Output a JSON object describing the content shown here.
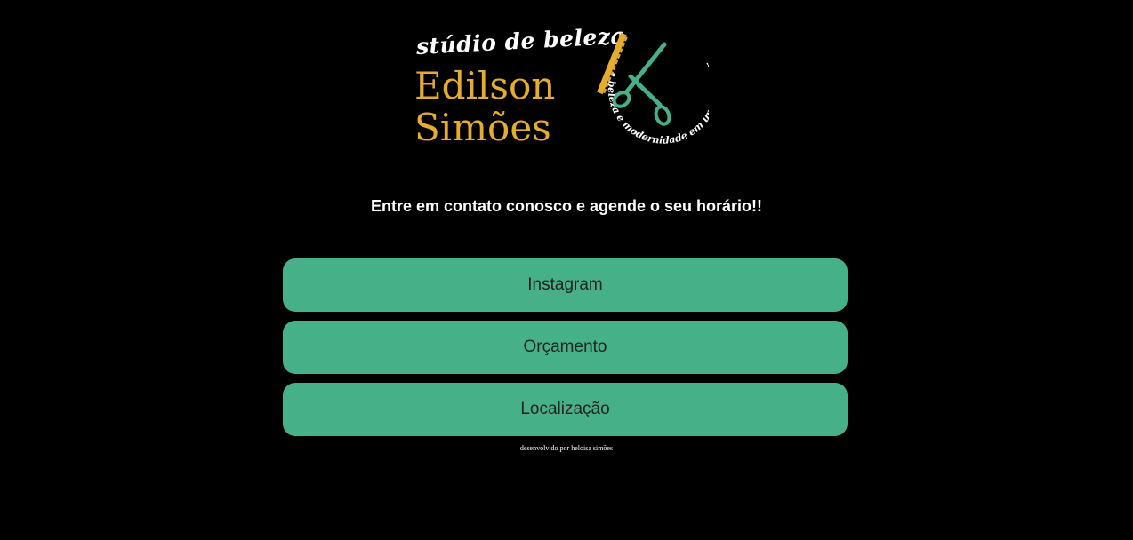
{
  "brand": {
    "script_line": "stúdio de beleza",
    "name_line1": "Edilson",
    "name_line2": "Simões",
    "circle_text": "• beleza e modernidade em um só lugar",
    "colors": {
      "gold": "#e6ac2e",
      "green": "#46b088",
      "white": "#ffffff"
    },
    "emblem_icons": [
      "comb-icon",
      "scissors-icon"
    ]
  },
  "tagline": "Entre em contato conosco e agende o seu horário!!",
  "links": [
    {
      "label": "Instagram"
    },
    {
      "label": "Orçamento"
    },
    {
      "label": "Localização"
    }
  ],
  "footer": {
    "credit": "desenvolvido por heloisa simões"
  },
  "theme": {
    "background": "#000000",
    "button_color": "#46b088",
    "button_text_color": "#222222"
  }
}
